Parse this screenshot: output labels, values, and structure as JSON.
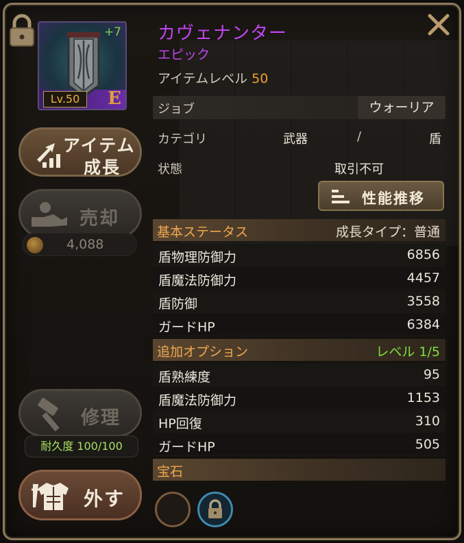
{
  "item": {
    "name": "カヴェナンター",
    "rarity": "エピック",
    "item_level_label": "アイテムレベル",
    "item_level": "50",
    "enhance": "+7",
    "level_badge": "Lv.50",
    "grade": "E"
  },
  "info": {
    "job_label": "ジョブ",
    "job_value": "ウォーリア",
    "category_label": "カテゴリ",
    "category_main": "武器",
    "category_sep": "/",
    "category_sub": "盾",
    "state_label": "状態",
    "state_value": "取引不可",
    "performance_button": "性能推移"
  },
  "basic_status": {
    "title": "基本ステータス",
    "growth_type": "成長タイプ：普通",
    "stats": [
      {
        "label": "盾物理防御力",
        "value": "6856"
      },
      {
        "label": "盾魔法防御力",
        "value": "4457"
      },
      {
        "label": "盾防御",
        "value": "3558"
      },
      {
        "label": "ガードHP",
        "value": "6384"
      }
    ]
  },
  "extra_options": {
    "title": "追加オプション",
    "level": "レベル 1/5",
    "stats": [
      {
        "label": "盾熟練度",
        "value": "95"
      },
      {
        "label": "盾魔法防御力",
        "value": "1153"
      },
      {
        "label": "HP回復",
        "value": "310"
      },
      {
        "label": "ガードHP",
        "value": "505"
      }
    ]
  },
  "gems": {
    "title": "宝石"
  },
  "left": {
    "grow_line1": "アイテム",
    "grow_line2": "成長",
    "sell": "売却",
    "coins": "4,088",
    "repair": "修理",
    "durability": "耐久度 100/100",
    "remove": "外す"
  },
  "colors": {
    "epic": "#c046f0",
    "level": "#f0a030",
    "section": "#f0a850",
    "option_level": "#7fe040"
  }
}
